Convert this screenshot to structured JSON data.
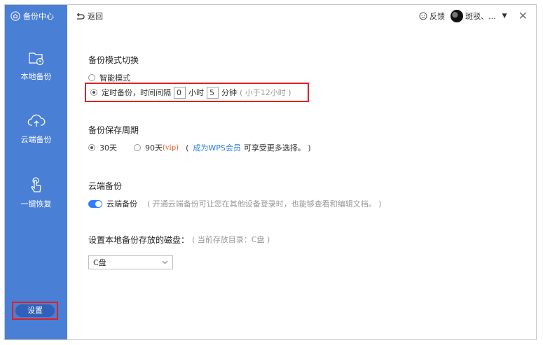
{
  "sidebar": {
    "header_label": "备份中心",
    "items": [
      {
        "label": "本地备份",
        "icon": "local-folder-clock-icon"
      },
      {
        "label": "云端备份",
        "icon": "cloud-upload-icon"
      },
      {
        "label": "一键恢复",
        "icon": "tap-hand-icon"
      }
    ],
    "settings_label": "设置"
  },
  "topbar": {
    "back_label": "返回",
    "feedback_label": "反馈",
    "username": "斑驳、..."
  },
  "backup_mode": {
    "title": "备份模式切换",
    "smart_label": "智能模式",
    "timed_label": "定时备份，时间间隔",
    "hours_value": "0",
    "hours_unit": "小时",
    "minutes_value": "5",
    "minutes_unit": "分钟",
    "hint": "( 小于12小时 )",
    "selected": "timed"
  },
  "retention": {
    "title": "备份保存周期",
    "option_30": "30天",
    "option_90": "90天",
    "vip_tag": "(vip)",
    "paren_open": "(",
    "member_link": "成为WPS会员",
    "member_suffix": "可享受更多选择。 )",
    "selected": "30天"
  },
  "cloud": {
    "title": "云端备份",
    "toggle_label": "云端备份",
    "toggle_on": true,
    "description": "( 开通云端备份可让您在其他设备登录时，也能够查看和编辑文档。 )"
  },
  "disk": {
    "title": "设置本地备份存放的磁盘：",
    "current_hint": "( 当前存放目录：C盘 )",
    "selected": "C盘"
  },
  "colors": {
    "sidebar": "#4a7fd6",
    "highlight_border": "#e02020",
    "link": "#2c7be5",
    "toggle": "#2d7ff9"
  }
}
